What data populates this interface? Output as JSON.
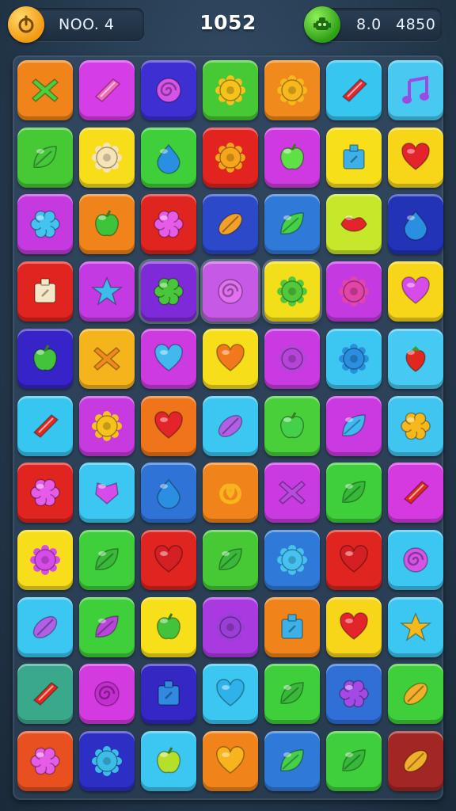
{
  "hud": {
    "level_label": "NOO. 4",
    "score": "1052",
    "moves": "8.0",
    "target": "4850",
    "colors": {
      "power_button": "#f5a623",
      "robot_badge": "#3cb521"
    }
  },
  "board": {
    "rows": 11,
    "cols": 7,
    "tiles": [
      [
        {
          "bg": "#f0841a",
          "gem": "x-icon",
          "gc": "#4ccf3a"
        },
        {
          "bg": "#d53de6",
          "gem": "diamond-icon",
          "gc": "#f26ab8"
        },
        {
          "bg": "#3d2fd1",
          "gem": "swirl-icon",
          "gc": "#d653e8"
        },
        {
          "bg": "#46c935",
          "gem": "gear-icon",
          "gc": "#f7c21b"
        },
        {
          "bg": "#f08a1c",
          "gem": "gear-icon",
          "gc": "#f7b81c"
        },
        {
          "bg": "#36c6f0",
          "gem": "diamond-icon",
          "gc": "#e0282f"
        },
        {
          "bg": "#48c9f2",
          "gem": "music-note-icon",
          "gc": "#9b4be3"
        }
      ],
      [
        {
          "bg": "#46c935",
          "gem": "leaf-icon",
          "gc": "#44c73a"
        },
        {
          "bg": "#f7dd1a",
          "gem": "gear-icon",
          "gc": "#f6e3b8"
        },
        {
          "bg": "#3fcf3a",
          "gem": "drop-icon",
          "gc": "#2a8fe0"
        },
        {
          "bg": "#e3231f",
          "gem": "gear-icon",
          "gc": "#f7a61c"
        },
        {
          "bg": "#cf3ae0",
          "gem": "apple-icon",
          "gc": "#5fe046"
        },
        {
          "bg": "#f7df1a",
          "gem": "box-icon",
          "gc": "#3cb1e8"
        },
        {
          "bg": "#f7d61a",
          "gem": "heart-icon",
          "gc": "#e3242b"
        }
      ],
      [
        {
          "bg": "#c53ae0",
          "gem": "flower-icon",
          "gc": "#43c3f0"
        },
        {
          "bg": "#f0841a",
          "gem": "apple-icon",
          "gc": "#3ec43a"
        },
        {
          "bg": "#e0241f",
          "gem": "flower-icon",
          "gc": "#e65be8"
        },
        {
          "bg": "#2b49c9",
          "gem": "football-icon",
          "gc": "#f2a02a"
        },
        {
          "bg": "#2f7ad8",
          "gem": "leaf-icon",
          "gc": "#45d04a"
        },
        {
          "bg": "#c7e82a",
          "gem": "lips-icon",
          "gc": "#e3242b"
        },
        {
          "bg": "#2233b8",
          "gem": "drop-icon",
          "gc": "#2a8fe0"
        }
      ],
      [
        {
          "bg": "#e0241f",
          "gem": "box-icon",
          "gc": "#f3e7c7"
        },
        {
          "bg": "#c33ae3",
          "gem": "star-icon",
          "gc": "#3cbde8"
        },
        {
          "bg": "#7f2ad8",
          "gem": "flower-icon",
          "gc": "#49c73a",
          "sel": true
        },
        {
          "bg": "#c65ae6",
          "gem": "swirl-icon",
          "gc": "#e171f0",
          "sel": true
        },
        {
          "bg": "#f2df1a",
          "gem": "gear-icon",
          "gc": "#52c93a",
          "sel": true
        },
        {
          "bg": "#c53ae0",
          "gem": "gear-icon",
          "gc": "#e344a8"
        },
        {
          "bg": "#f7d61a",
          "gem": "heart-icon",
          "gc": "#d74be8"
        }
      ],
      [
        {
          "bg": "#3624c9",
          "gem": "apple-icon",
          "gc": "#43c33a"
        },
        {
          "bg": "#f5b41c",
          "gem": "x-icon",
          "gc": "#f08a1c"
        },
        {
          "bg": "#cc3ae0",
          "gem": "heart-icon",
          "gc": "#41b9f0"
        },
        {
          "bg": "#f7de1a",
          "gem": "heart-icon",
          "gc": "#f2781c"
        },
        {
          "bg": "#c93ae3",
          "gem": "gear-icon",
          "gc": "#b545d8"
        },
        {
          "bg": "#3cc7f2",
          "gem": "gear-icon",
          "gc": "#2a8fe0"
        },
        {
          "bg": "#46c9f2",
          "gem": "strawberry-icon",
          "gc": "#e0281f"
        }
      ],
      [
        {
          "bg": "#36c6f0",
          "gem": "diamond-icon",
          "gc": "#e0281f"
        },
        {
          "bg": "#c63ae0",
          "gem": "gear-icon",
          "gc": "#f7c21b"
        },
        {
          "bg": "#f0741a",
          "gem": "heart-icon",
          "gc": "#e3242b"
        },
        {
          "bg": "#3cc7f2",
          "gem": "football-icon",
          "gc": "#b060e6"
        },
        {
          "bg": "#48cf3a",
          "gem": "apple-icon",
          "gc": "#45d04a"
        },
        {
          "bg": "#c93ae0",
          "gem": "leaf-icon",
          "gc": "#41b9f0"
        },
        {
          "bg": "#40c4f0",
          "gem": "flower-icon",
          "gc": "#f7b81c"
        }
      ],
      [
        {
          "bg": "#e0241f",
          "gem": "flower-icon",
          "gc": "#e65be8"
        },
        {
          "bg": "#3cc7f2",
          "gem": "shield-icon",
          "gc": "#d74be8"
        },
        {
          "bg": "#2f73d6",
          "gem": "drop-icon",
          "gc": "#2a8fe0"
        },
        {
          "bg": "#f0841a",
          "gem": "pretzel-icon",
          "gc": "#f7b41c"
        },
        {
          "bg": "#c93ae0",
          "gem": "x-icon",
          "gc": "#b64be0"
        },
        {
          "bg": "#3fcf3a",
          "gem": "leaf-icon",
          "gc": "#36b83a"
        },
        {
          "bg": "#d43ae0",
          "gem": "diamond-icon",
          "gc": "#e0281f"
        }
      ],
      [
        {
          "bg": "#f7dd1a",
          "gem": "gear-icon",
          "gc": "#d74be8"
        },
        {
          "bg": "#3fcf3a",
          "gem": "leaf-icon",
          "gc": "#3ab83a"
        },
        {
          "bg": "#e0241f",
          "gem": "heart-icon",
          "gc": "#d41f24"
        },
        {
          "bg": "#46c935",
          "gem": "leaf-icon",
          "gc": "#3ab83a"
        },
        {
          "bg": "#2f7ad8",
          "gem": "gear-icon",
          "gc": "#46c2f0"
        },
        {
          "bg": "#e0241f",
          "gem": "heart-icon",
          "gc": "#d41f24"
        },
        {
          "bg": "#3cc7f2",
          "gem": "swirl-icon",
          "gc": "#d653e8"
        }
      ],
      [
        {
          "bg": "#3cc7f2",
          "gem": "football-icon",
          "gc": "#b060e6"
        },
        {
          "bg": "#3fcf3a",
          "gem": "leaf-icon",
          "gc": "#b645d8"
        },
        {
          "bg": "#f7df1a",
          "gem": "apple-icon",
          "gc": "#42c33a"
        },
        {
          "bg": "#a83ae0",
          "gem": "gear-icon",
          "gc": "#9b3ed8"
        },
        {
          "bg": "#f0841a",
          "gem": "box-icon",
          "gc": "#3cb1e8"
        },
        {
          "bg": "#f7d61a",
          "gem": "heart-icon",
          "gc": "#e3242b"
        },
        {
          "bg": "#3cc7f2",
          "gem": "star-icon",
          "gc": "#f7b81c"
        }
      ],
      [
        {
          "bg": "#3aa88a",
          "gem": "diamond-icon",
          "gc": "#e0281f"
        },
        {
          "bg": "#d33ae0",
          "gem": "swirl-icon",
          "gc": "#c42ed0"
        },
        {
          "bg": "#3427c4",
          "gem": "box-icon",
          "gc": "#2f8ae0"
        },
        {
          "bg": "#3cc7f2",
          "gem": "heart-icon",
          "gc": "#2fb2ea"
        },
        {
          "bg": "#3fcf3a",
          "gem": "leaf-icon",
          "gc": "#3ab83a"
        },
        {
          "bg": "#2f6fd6",
          "gem": "flower-icon",
          "gc": "#a349e6"
        },
        {
          "bg": "#3fcf3a",
          "gem": "football-icon",
          "gc": "#f2b02a"
        }
      ],
      [
        {
          "bg": "#e8511f",
          "gem": "flower-icon",
          "gc": "#e65be8"
        },
        {
          "bg": "#2d2fc4",
          "gem": "gear-icon",
          "gc": "#3cbde8"
        },
        {
          "bg": "#3cc7f2",
          "gem": "apple-icon",
          "gc": "#b5e02a"
        },
        {
          "bg": "#f0841a",
          "gem": "heart-icon",
          "gc": "#f7b41c"
        },
        {
          "bg": "#2f7ad8",
          "gem": "leaf-icon",
          "gc": "#45d04a"
        },
        {
          "bg": "#3fcf3a",
          "gem": "leaf-icon",
          "gc": "#36b83a"
        },
        {
          "bg": "#a22624",
          "gem": "football-icon",
          "gc": "#f2b02a"
        }
      ]
    ]
  }
}
